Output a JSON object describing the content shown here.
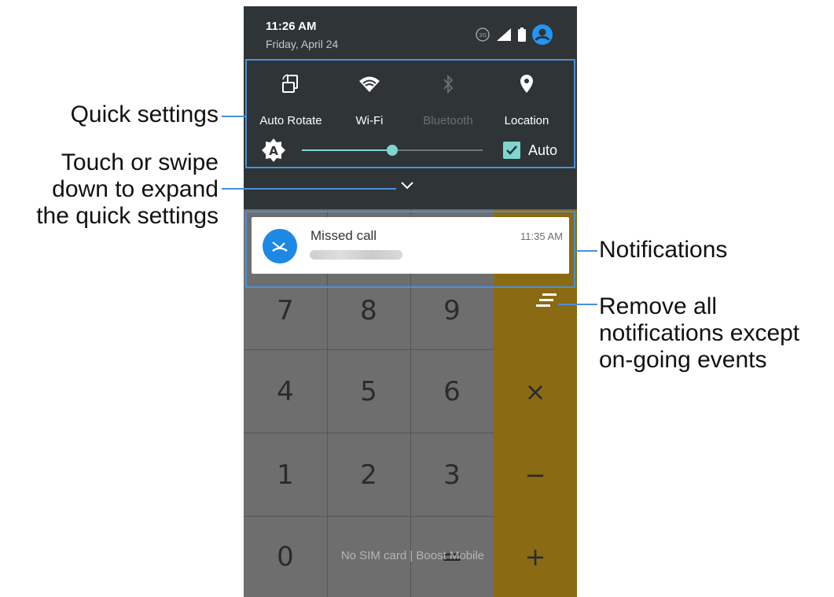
{
  "status_bar": {
    "time": "11:26 AM",
    "date": "Friday, April 24",
    "icons": [
      "data-saver-icon",
      "signal-icon",
      "battery-icon",
      "account-icon"
    ]
  },
  "quick_settings": {
    "tiles": [
      {
        "label": "Auto Rotate",
        "icon": "auto-rotate-icon",
        "state": "on"
      },
      {
        "label": "Wi-Fi",
        "icon": "wifi-icon",
        "state": "on"
      },
      {
        "label": "Bluetooth",
        "icon": "bluetooth-icon",
        "state": "off"
      },
      {
        "label": "Location",
        "icon": "location-icon",
        "state": "on"
      }
    ],
    "brightness": {
      "level": 0.5,
      "auto_checked": true,
      "auto_label": "Auto"
    }
  },
  "notification": {
    "title": "Missed call",
    "time": "11:35 AM",
    "icon": "missed-call-icon"
  },
  "calculator": {
    "rows": [
      [
        "7",
        "8",
        "9",
        "÷"
      ],
      [
        "4",
        "5",
        "6",
        "×"
      ],
      [
        "1",
        "2",
        "3",
        "−"
      ],
      [
        "0",
        "",
        "=",
        "+"
      ]
    ],
    "carrier_text": "No SIM card | Boost Mobile"
  },
  "callouts": {
    "quick_settings": "Quick settings",
    "expand": [
      "Touch or swipe",
      "down to expand",
      "the quick settings"
    ],
    "notifications": "Notifications",
    "clear_all": [
      "Remove all",
      "notifications except",
      "on-going events"
    ]
  },
  "colors": {
    "accent": "#7fd6d0",
    "callout_blue": "#4a90d9",
    "shade_bg": "#2f3437",
    "notification_icon": "#1e88e5",
    "operator_column": "#8a6a12"
  }
}
